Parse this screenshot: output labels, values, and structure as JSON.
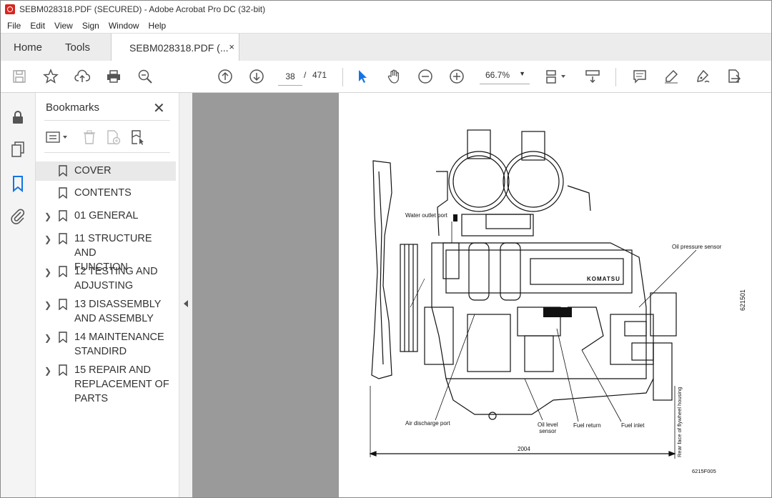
{
  "window": {
    "title": "SEBM028318.PDF (SECURED) - Adobe Acrobat Pro DC (32-bit)"
  },
  "menu": [
    "File",
    "Edit",
    "View",
    "Sign",
    "Window",
    "Help"
  ],
  "tabs": {
    "home": "Home",
    "tools": "Tools",
    "document": "SEBM028318.PDF (...",
    "close": "×"
  },
  "toolbar": {
    "page_current": "38",
    "page_separator": "/",
    "page_total": "471",
    "zoom": "66.7%"
  },
  "bookmarks": {
    "title": "Bookmarks",
    "close": "✕",
    "items": [
      {
        "label": "COVER",
        "expandable": false
      },
      {
        "label": "CONTENTS",
        "expandable": false
      },
      {
        "label": "01 GENERAL",
        "expandable": true
      },
      {
        "label": "11 STRUCTURE AND\nFUNCTION",
        "expandable": true
      },
      {
        "label": "12 TESTING AND\nADJUSTING",
        "expandable": true
      },
      {
        "label": "13 DISASSEMBLY\nAND ASSEMBLY",
        "expandable": true
      },
      {
        "label": "14 MAINTENANCE\nSTANDIRD",
        "expandable": true
      },
      {
        "label": "15 REPAIR AND\nREPLACEMENT OF\nPARTS",
        "expandable": true
      }
    ]
  },
  "document": {
    "labels": {
      "water_outlet": "Water outlet port",
      "oil_pressure": "Oil pressure sensor",
      "air_discharge": "Air discharge port",
      "oil_level": "Oil level\nsensor",
      "fuel_return": "Fuel return",
      "fuel_inlet": "Fuel inlet",
      "dimension": "2004",
      "rear_face": "Rear face of flywheel housing",
      "side_id": "621501",
      "figure_id": "6215F005",
      "brand": "KOMATSU"
    }
  },
  "colors": {
    "accent": "#1473e6",
    "pdf_red": "#d7261e",
    "doc_bg": "#9a9a9a"
  }
}
